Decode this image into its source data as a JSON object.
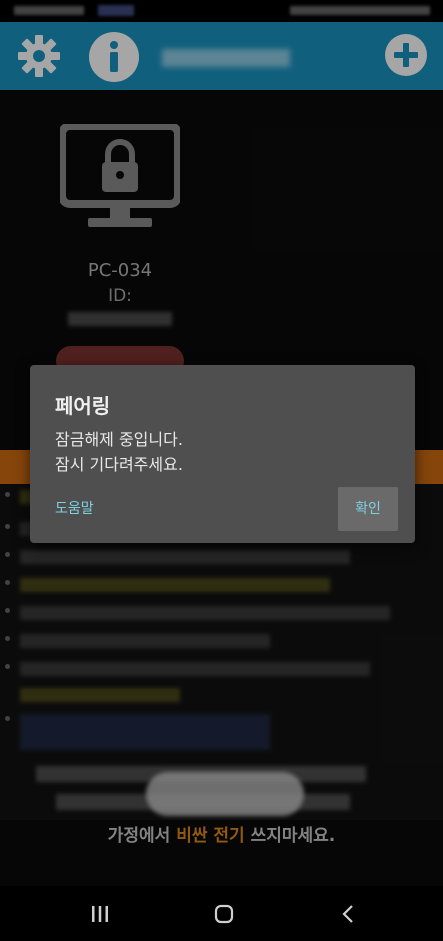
{
  "app": {
    "pc_name": "PC-034",
    "id_label": "ID:"
  },
  "dialog": {
    "title": "페어링",
    "message_line1": "잠금해제 중입니다.",
    "message_line2": "잠시 기다려주세요.",
    "help_label": "도움말",
    "ok_label": "확인"
  },
  "footer": {
    "text_before": "가정에서 ",
    "text_highlight": "비싼 전기",
    "text_after": " 쓰지마세요."
  },
  "icons": {
    "settings": "gear-icon",
    "info": "info-icon",
    "add": "plus-circle-icon",
    "locked_monitor": "locked-monitor-icon"
  },
  "colors": {
    "app_bar": "#1a93c1",
    "accent": "#7fd0e3",
    "highlight": "#e08a1a",
    "dialog_bg": "#4f4f4f"
  }
}
